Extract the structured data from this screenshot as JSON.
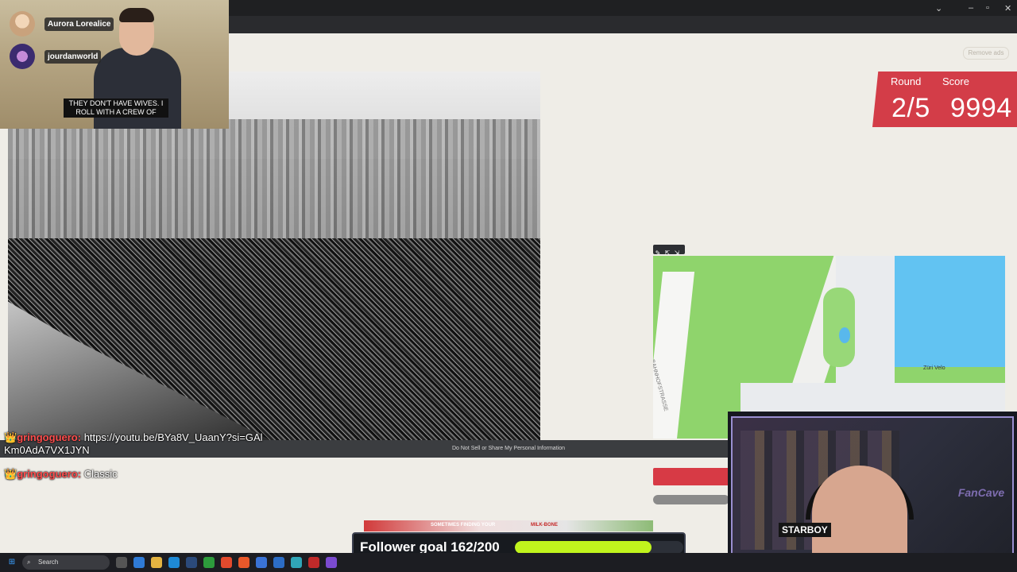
{
  "browser": {
    "window_controls": [
      "–",
      "▫",
      "✕"
    ]
  },
  "page": {
    "remove_ads_label": "Remove ads",
    "round_label": "Round",
    "score_label": "Score",
    "round_value": "2/5",
    "score_value": "9994",
    "do_not_sell_text": "Do Not Sell or Share My Personal Information",
    "accent_color": "#d33d48"
  },
  "map": {
    "labels": {
      "street": "BAHNHOFSTRASSE",
      "poi": "Züri Velo"
    }
  },
  "stream": {
    "users": [
      {
        "name": "Aurora Lorealice"
      },
      {
        "name": "jourdanworld"
      }
    ],
    "caption": "THEY DON'T HAVE WIVES. I ROLL WITH A CREW OF",
    "chat": [
      {
        "crown": "👑",
        "user": "gringoguero:",
        "message": "https://youtu.be/BYa8V_UaanY?si=GAlKm0AdA7VX1JYN"
      },
      {
        "crown": "👑",
        "user": "gringoguero:",
        "message": "Classic"
      }
    ],
    "follower_goal": {
      "label": "Follower goal 162/200",
      "current": 162,
      "target": 200,
      "fill_color": "#c0f41d"
    },
    "ad": {
      "text1": "SOMETIMES FINDING YOUR",
      "text2": "MILK-BONE"
    },
    "cam2": {
      "starboy": "STARBOY",
      "fancave": "FanCave"
    }
  },
  "taskbar": {
    "search_placeholder": "Search"
  }
}
